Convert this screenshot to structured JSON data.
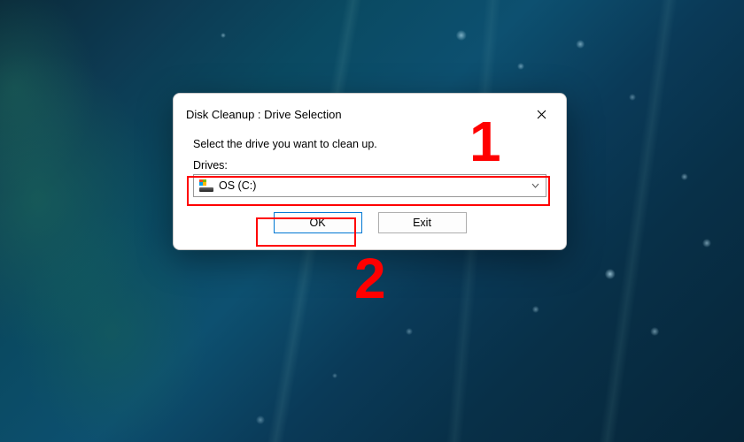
{
  "dialog": {
    "title": "Disk Cleanup : Drive Selection",
    "instruction": "Select the drive you want to clean up.",
    "drives_label": "Drives:",
    "selected_drive": "OS (C:)",
    "ok_label": "OK",
    "exit_label": "Exit"
  },
  "annotations": {
    "label1": "1",
    "label2": "2"
  }
}
